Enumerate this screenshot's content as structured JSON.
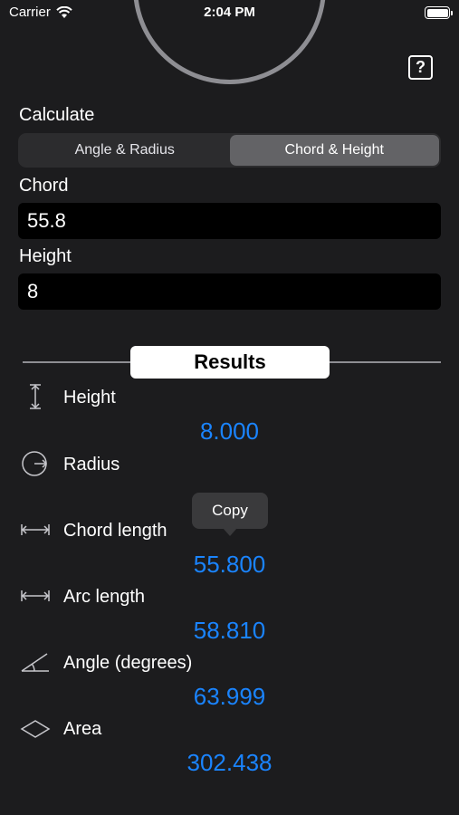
{
  "status_bar": {
    "carrier": "Carrier",
    "time": "2:04 PM"
  },
  "help": {
    "label": "?"
  },
  "calculate": {
    "label": "Calculate",
    "segments": [
      {
        "label": "Angle & Radius",
        "selected": false
      },
      {
        "label": "Chord & Height",
        "selected": true
      }
    ]
  },
  "inputs": {
    "chord": {
      "label": "Chord",
      "value": "55.8"
    },
    "height": {
      "label": "Height",
      "value": "8"
    }
  },
  "results": {
    "title": "Results",
    "rows": [
      {
        "label": "Height",
        "value": "8.000",
        "icon": "height-icon"
      },
      {
        "label": "Radius",
        "value": "",
        "icon": "radius-icon"
      },
      {
        "label": "Chord length",
        "value": "55.800",
        "icon": "chord-icon"
      },
      {
        "label": "Arc length",
        "value": "58.810",
        "icon": "arc-length-icon"
      },
      {
        "label": "Angle (degrees)",
        "value": "63.999",
        "icon": "angle-icon"
      },
      {
        "label": "Area",
        "value": "302.438",
        "icon": "area-icon"
      }
    ]
  },
  "tooltip": {
    "label": "Copy"
  },
  "colors": {
    "background": "#1c1c1e",
    "accent": "#1a84ff",
    "field": "#000000"
  }
}
